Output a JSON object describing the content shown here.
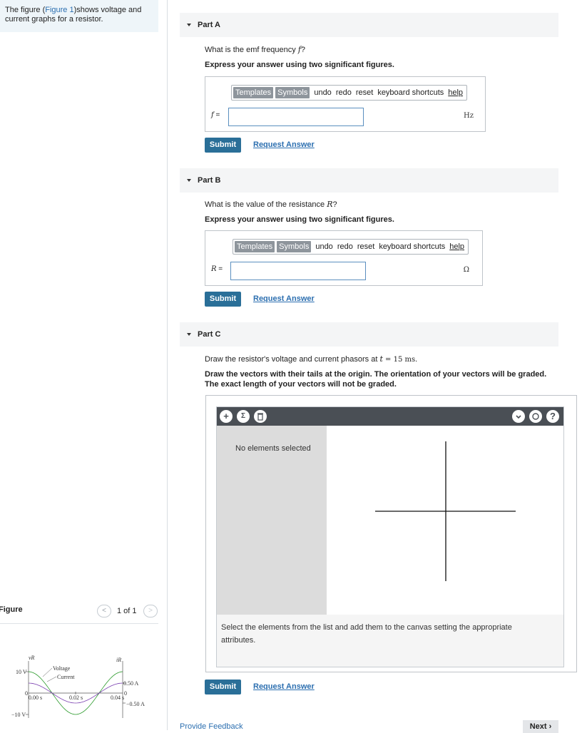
{
  "intro": {
    "text_before": "The figure (",
    "link": "Figure 1",
    "text_after": ")shows voltage and current graphs for a resistor."
  },
  "figure": {
    "title": "Figure",
    "pager": "1 of 1",
    "prev": "<",
    "next": ">",
    "graph": {
      "v_axis_label": "vR",
      "i_axis_label": "iR",
      "v_max": "10 V",
      "v_zero": "0",
      "v_min": "−10 V",
      "i_max": "0.50 A",
      "i_zero": "0",
      "i_min": "−0.50 A",
      "t0": "0.00 s",
      "t1": "0.02 s",
      "t2": "0.04 s",
      "voltage_label": "Voltage",
      "current_label": "Current",
      "voltage_color": "#2b9a2b",
      "current_color": "#7a3fb0"
    }
  },
  "partA": {
    "header": "Part A",
    "question": "What is the emf frequency ",
    "question_var": "f",
    "question_end": "?",
    "instruction": "Express your answer using two significant figures.",
    "var_label": "f",
    "equals": " =",
    "unit": "Hz",
    "input_value": ""
  },
  "partB": {
    "header": "Part B",
    "question": "What is the value of the resistance ",
    "question_var": "R",
    "question_end": "?",
    "instruction": "Express your answer using two significant figures.",
    "var_label": "R",
    "equals": " =",
    "unit": "Ω",
    "input_value": ""
  },
  "toolbar": {
    "templates": "Templates",
    "symbols": "Symbols",
    "undo": "undo",
    "redo": "redo",
    "reset": "reset",
    "shortcuts": "keyboard shortcuts",
    "help": "help"
  },
  "buttons": {
    "submit": "Submit",
    "request": "Request Answer"
  },
  "partC": {
    "header": "Part C",
    "question": "Draw the resistor's voltage and current phasors at ",
    "question_var": "t",
    "question_eq": " = 15 ms",
    "question_end": ".",
    "instruction": "Draw the vectors with their tails at the origin. The orientation of your vectors will be graded. The exact length of your vectors will not be graded.",
    "no_elements": "No elements selected",
    "select_instructions": "Select the elements from the list and add them to the canvas setting the appropriate attributes.",
    "tool_icons": {
      "add": "+",
      "sum": "Σ",
      "delete": "trash-icon",
      "collapse": "chevron-down-icon",
      "reset": "refresh-icon",
      "help": "?"
    }
  },
  "footer": {
    "feedback": "Provide Feedback",
    "next": "Next"
  }
}
